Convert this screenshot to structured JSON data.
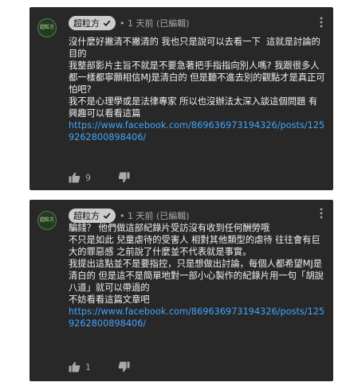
{
  "comments": [
    {
      "avatar_text": "超粒方",
      "author": "超粒方",
      "time": "• 1 天前 (已編輯)",
      "text_lines": [
        "沒什麼好撇清不撇清的 我也只是說可以去看一下  這就是討論的目的",
        "我整部影片主旨不就是不要急著把手指指向別人嗎? 我跟很多人都一樣都寧願相信MJ是清白的 但是聽不進去別的觀點才是真正可怕吧?",
        "我不是心理學或是法律專家 所以也沒辦法太深入談這個問題 有興趣可以看看這篇"
      ],
      "link": "https://www.facebook.com/869636973194326/posts/1259262800898406/",
      "likes": "9"
    },
    {
      "avatar_text": "超粒方",
      "author": "超粒方",
      "time": "• 1 天前 (已編輯)",
      "text_lines": [
        "騙錢？ 他們做這部紀錄片受訪沒有收到任何酬勞哦",
        "不只是如此 兒童虐待的受害人 相對其他類型的虐待 往往會有巨大的罪惡感 之前說了什麼並不代表就是事實。",
        "我提出這點並不是要指控，只是想做出討論，每個人都希望MJ是清白的 但是這不是簡單地對一部小心製作的紀錄片用一句「胡說八道」就可以帶過的",
        "不妨看看這篇文章吧"
      ],
      "link": "https://www.facebook.com/869636973194326/posts/1259262800898406/",
      "likes": "1"
    }
  ],
  "icons": {
    "verified": "check-icon",
    "like": "thumbs-up-icon",
    "dislike": "thumbs-down-icon",
    "menu": "more-vertical-icon"
  },
  "colors": {
    "card_bg": "#282828",
    "badge_bg": "#cccccc",
    "link": "#3ea6ff",
    "meta": "#aaaaaa"
  }
}
